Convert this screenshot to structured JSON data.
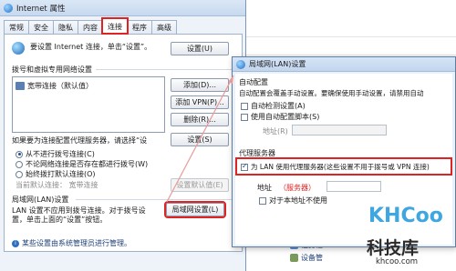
{
  "colors": {
    "highlight_red": "#e02222",
    "title_bar": "#c7d9ef",
    "watermark_blue": "#3ea6e0"
  },
  "ie_window": {
    "title": "Internet 属性",
    "tabs": [
      "常规",
      "安全",
      "隐私",
      "内容",
      "连接",
      "程序",
      "高级"
    ],
    "active_tab_index": 4,
    "setup_text": "要设置 Internet 连接，单击“设置”。",
    "setup_button": "设置(U)",
    "dialup_heading": "拨号和虚拟专用网络设置",
    "connection_item": "宽带连接（默认值）",
    "add_button": "添加(D)...",
    "add_vpn_button": "添加 VPN(P)...",
    "remove_button": "删除(R)...",
    "settings_button": "设置(S)",
    "proxy_text": "如果要为连接配置代理服务器，请选择“设",
    "radio_options": [
      "从不进行拨号连接(C)",
      "不论网络连接是否存在都进行拨号(W)",
      "始终拨打默认连接(O)"
    ],
    "radio_selected": 0,
    "current_default_label": "当前默认连接：",
    "current_default_value": "宽带连接",
    "set_default_button": "设置默认值(E)",
    "lan_heading": "局域网(LAN)设置",
    "lan_desc_1": "LAN 设置不应用到拨号连接。对于拨号设",
    "lan_desc_2": "置，单击上面的“设置”按钮。",
    "lan_button": "局域网设置(L)",
    "admin_note": "某些设置由系统管理员进行管理。"
  },
  "lan_dialog": {
    "title": "局域网(LAN)设置",
    "auto_config_heading": "自动配置",
    "auto_config_desc": "自动配置会覆盖手动设置。要确保使用手动设置，请禁用自动",
    "auto_detect": "自动检测设置(A)",
    "use_script": "使用自动配置脚本(S)",
    "address_label": "地址(R)",
    "proxy_heading": "代理服务器",
    "use_proxy": "为 LAN 使用代理服务器(这些设置不用于拨号或 VPN 连接)",
    "address2_label": "地址",
    "address2_value": "（服务器）",
    "bypass_local": "对于本地址不使用"
  },
  "background": {
    "links": [
      "任务栏",
      "设备管"
    ]
  },
  "watermark": {
    "brand": "KHCoo",
    "cn": "科技库",
    "url": "khcoo.com"
  }
}
